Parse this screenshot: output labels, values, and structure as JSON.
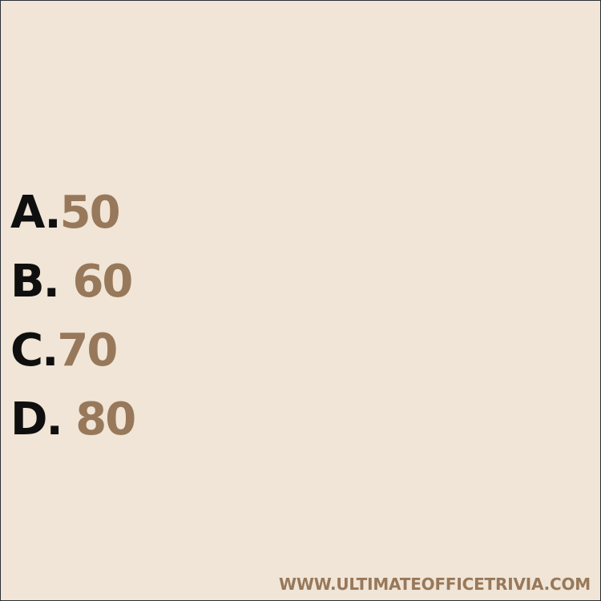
{
  "options": [
    {
      "letter": "A.",
      "value": "50"
    },
    {
      "letter": "B.",
      "value": "60"
    },
    {
      "letter": "C.",
      "value": "70"
    },
    {
      "letter": "D.",
      "value": "80"
    }
  ],
  "footer": {
    "website": "WWW.ULTIMATEOFFICETRIVIA.COM"
  },
  "colors": {
    "background": "#f0e5d6",
    "letter": "#0f0f0f",
    "accent": "#98785a",
    "border": "#2b2f36"
  }
}
